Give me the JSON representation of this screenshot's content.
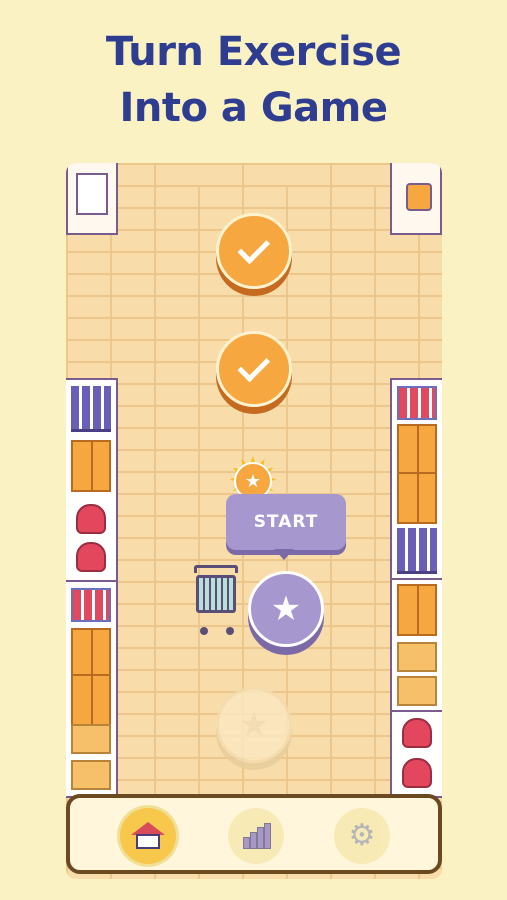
{
  "header": {
    "line1": "Turn Exercise",
    "line2": "Into a Game"
  },
  "levels": [
    {
      "state": "completed",
      "icon": "checkmark-icon"
    },
    {
      "state": "completed",
      "icon": "checkmark-icon"
    },
    {
      "state": "current",
      "icon": "star-icon"
    },
    {
      "state": "locked",
      "icon": "star-icon"
    }
  ],
  "start_label": "START",
  "badge_icon": "star-badge-icon",
  "nav": {
    "items": [
      {
        "name": "home",
        "icon": "house-icon",
        "active": true
      },
      {
        "name": "stats",
        "icon": "bar-chart-icon",
        "active": false
      },
      {
        "name": "settings",
        "icon": "gear-icon",
        "active": false
      }
    ]
  },
  "colors": {
    "background": "#fbf2c4",
    "title": "#2e3d8f",
    "completed_coin": "#f7a73f",
    "current_coin": "#a698cf",
    "nav_border": "#6b4a22"
  }
}
